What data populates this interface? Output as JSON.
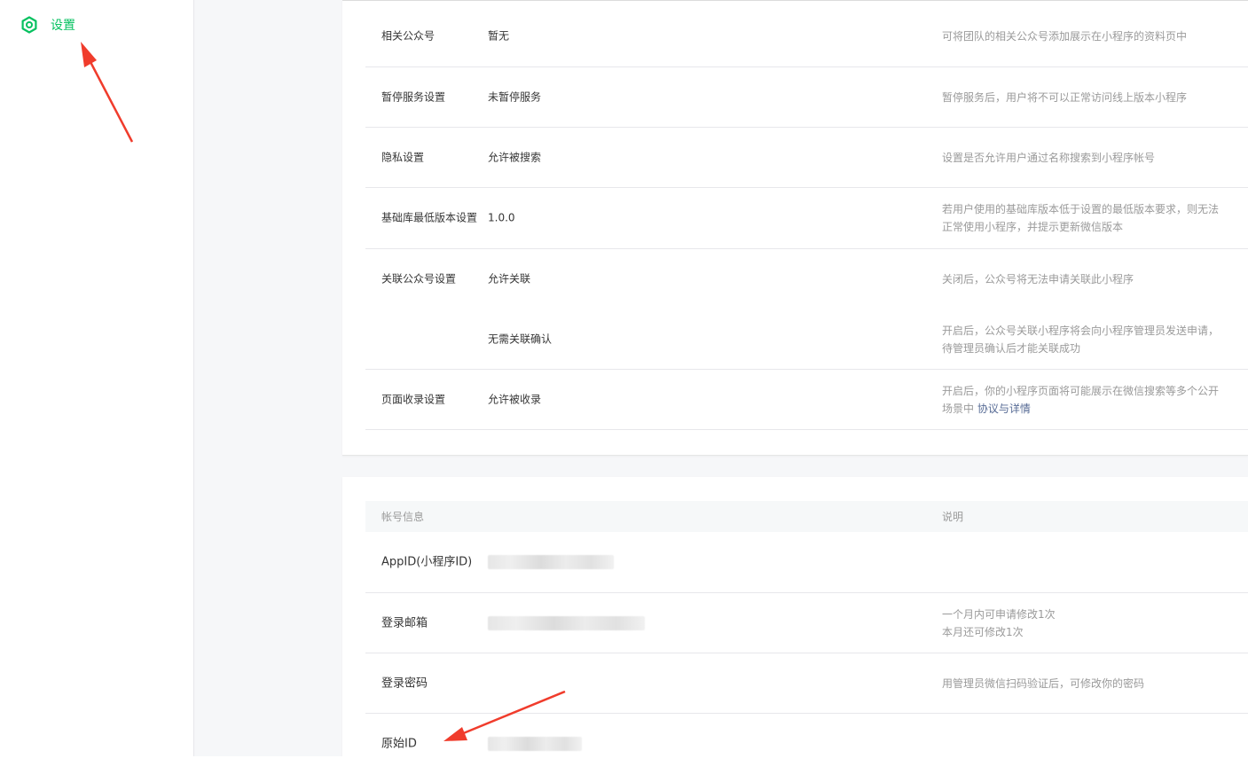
{
  "sidebar": {
    "settings_label": "设置",
    "accent_color": "#07c160",
    "icon": "gear-icon"
  },
  "settings_table": {
    "rows": [
      {
        "label": "相关公众号",
        "value": "暂无",
        "description": "可将团队的相关公众号添加展示在小程序的资料页中"
      },
      {
        "label": "暂停服务设置",
        "value": "未暂停服务",
        "description": "暂停服务后，用户将不可以正常访问线上版本小程序"
      },
      {
        "label": "隐私设置",
        "value": "允许被搜索",
        "description": "设置是否允许用户通过名称搜索到小程序帐号"
      },
      {
        "label": "基础库最低版本设置",
        "value": "1.0.0",
        "description": "若用户使用的基础库版本低于设置的最低版本要求，则无法正常使用小程序，并提示更新微信版本"
      },
      {
        "label": "关联公众号设置",
        "value": "允许关联",
        "description": "关闭后，公众号将无法申请关联此小程序"
      },
      {
        "label": "",
        "value": "无需关联确认",
        "description": "开启后，公众号关联小程序将会向小程序管理员发送申请，待管理员确认后才能关联成功"
      },
      {
        "label": "页面收录设置",
        "value": "允许被收录",
        "description": "开启后，你的小程序页面将可能展示在微信搜索等多个公开场景中",
        "link": "协议与详情"
      }
    ]
  },
  "account_table": {
    "header_info": "帐号信息",
    "header_desc": "说明",
    "rows": [
      {
        "label": "AppID(小程序ID)",
        "value_hidden": true,
        "description": ""
      },
      {
        "label": "登录邮箱",
        "value_hidden": true,
        "description_line1": "一个月内可申请修改1次",
        "description_line2": "本月还可修改1次"
      },
      {
        "label": "登录密码",
        "description": "用管理员微信扫码验证后，可修改你的密码"
      },
      {
        "label": "原始ID",
        "value_hidden": true,
        "description": ""
      }
    ]
  },
  "annotations": {
    "arrow_color": "#f03c2c"
  }
}
